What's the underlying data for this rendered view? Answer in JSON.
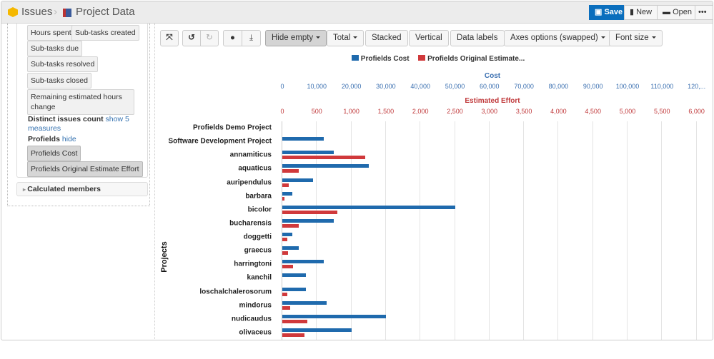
{
  "header": {
    "breadcrumb": [
      "Issues",
      "Project Data"
    ],
    "save": "Save",
    "new": "New",
    "open": "Open",
    "more": "•••"
  },
  "sidebar": {
    "measures": [
      "Hours spent",
      "Sub-tasks created",
      "Sub-tasks due",
      "Sub-tasks resolved",
      "Sub-tasks closed",
      "Remaining estimated hours change"
    ],
    "distinct_label": "Distinct issues count",
    "distinct_link": "show 5 measures",
    "profields_label": "Profields",
    "profields_link": "hide",
    "profields": [
      "Profields Cost",
      "Profields Original Estimate Effort"
    ],
    "calculated": "Calculated members"
  },
  "toolbar": {
    "hide_empty": "Hide empty",
    "total": "Total",
    "stacked": "Stacked",
    "vertical": "Vertical",
    "data_labels": "Data labels",
    "axes_options": "Axes options (swapped)",
    "font_size": "Font size"
  },
  "colors": {
    "cost": "#1f6aad",
    "effort": "#d0393b",
    "save": "#0a6ebd"
  },
  "chart_data": {
    "type": "bar",
    "orientation": "horizontal",
    "grid": true,
    "legend": "top",
    "ylabel": "Projects",
    "categories": [
      "Profields Demo Project",
      "Software Development Project",
      "annamiticus",
      "aquaticus",
      "auripendulus",
      "barbara",
      "bicolor",
      "bucharensis",
      "doggetti",
      "graecus",
      "harringtoni",
      "kanchil",
      "loschalchalerosorum",
      "mindorus",
      "nudicaudus",
      "olivaceus"
    ],
    "axes": [
      {
        "title": "Cost",
        "range": [
          0,
          120000
        ],
        "ticks": [
          "0",
          "10,000",
          "20,000",
          "30,000",
          "40,000",
          "50,000",
          "60,000",
          "70,000",
          "80,000",
          "90,000",
          "100,000",
          "110,000",
          "120,..."
        ]
      },
      {
        "title": "Estimated Effort",
        "range": [
          0,
          6000
        ],
        "ticks": [
          "0",
          "500",
          "1,000",
          "1,500",
          "2,000",
          "2,500",
          "3,000",
          "3,500",
          "4,000",
          "4,500",
          "5,000",
          "5,500",
          "6,000"
        ]
      }
    ],
    "series": [
      {
        "name": "Profields Cost",
        "axis": 0,
        "values": [
          null,
          12000,
          15000,
          25000,
          8800,
          2800,
          50000,
          15000,
          2800,
          4800,
          12000,
          6800,
          6800,
          12900,
          30000,
          20000
        ]
      },
      {
        "name": "Profields Original Estimate...",
        "axis": 1,
        "values": [
          null,
          null,
          1200,
          240,
          95,
          30,
          800,
          240,
          70,
          85,
          155,
          null,
          70,
          110,
          360,
          320
        ]
      }
    ]
  }
}
